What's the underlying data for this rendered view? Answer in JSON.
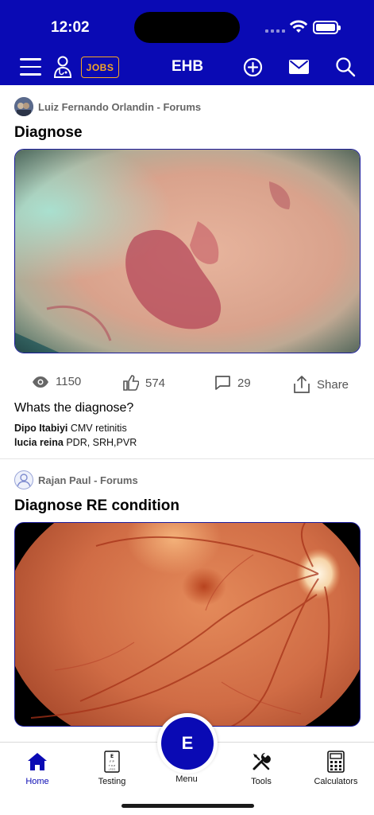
{
  "status_bar": {
    "time": "12:02"
  },
  "header": {
    "title": "EHB",
    "jobs_label": "JOBS",
    "icons": [
      "menu-icon",
      "doctor-icon",
      "add-circle-icon",
      "mail-icon",
      "search-icon"
    ]
  },
  "posts": [
    {
      "author": "Luiz Fernando Orlandin - Forums",
      "title": "Diagnose",
      "image": "retina-hemorrhage-photo",
      "stats": {
        "views": "1150",
        "likes": "574",
        "comments": "29",
        "share_label": "Share"
      },
      "body": "Whats the diagnose?",
      "comments_preview": [
        {
          "name": "Dipo Itabiyi",
          "text": "CMV retinitis"
        },
        {
          "name": "lucia reina",
          "text": "PDR, SRH,PVR"
        }
      ]
    },
    {
      "author": "Rajan Paul - Forums",
      "title": "Diagnose RE condition",
      "image": "fundus-photo"
    }
  ],
  "bottom_nav": {
    "items": [
      {
        "label": "Home",
        "icon": "home-icon",
        "active": true
      },
      {
        "label": "Testing",
        "icon": "eye-chart-icon"
      },
      {
        "label": "Menu",
        "icon": "menu-fab"
      },
      {
        "label": "Tools",
        "icon": "tools-icon"
      },
      {
        "label": "Calculators",
        "icon": "calculator-icon"
      }
    ],
    "fab_label": "E"
  },
  "colors": {
    "brand": "#0a0ab4",
    "jobs_accent": "#f5a623"
  }
}
